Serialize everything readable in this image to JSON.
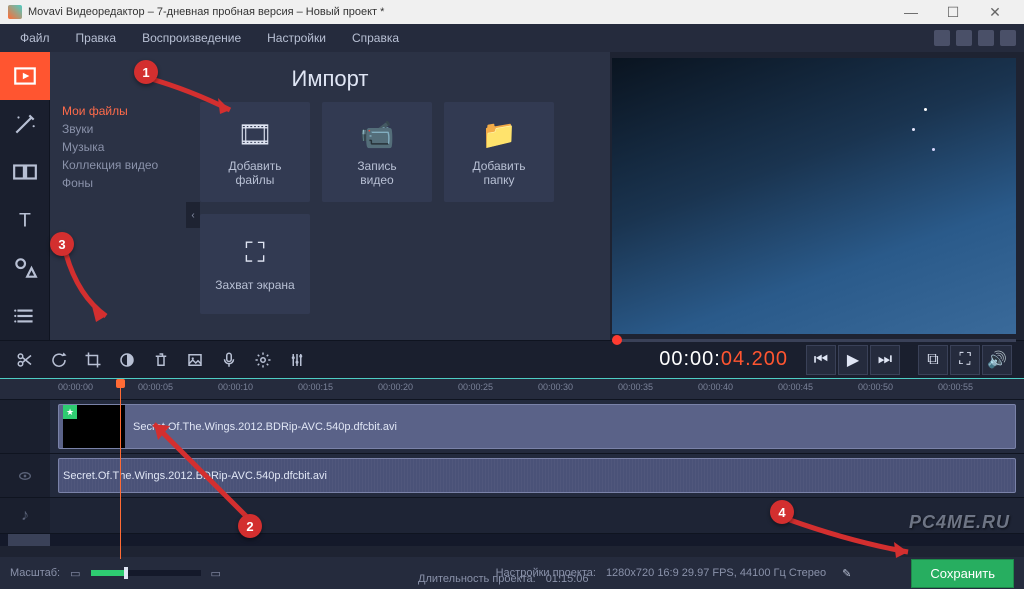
{
  "window": {
    "title": "Movavi Видеоредактор – 7-дневная пробная версия – Новый проект *"
  },
  "menu": {
    "file": "Файл",
    "edit": "Правка",
    "playback": "Воспроизведение",
    "settings": "Настройки",
    "help": "Справка"
  },
  "import": {
    "title": "Импорт",
    "sidebar": {
      "myfiles": "Мои файлы",
      "sounds": "Звуки",
      "music": "Музыка",
      "collection": "Коллекция видео",
      "backgrounds": "Фоны"
    },
    "tiles": {
      "add_files_l1": "Добавить",
      "add_files_l2": "файлы",
      "record_video_l1": "Запись",
      "record_video_l2": "видео",
      "add_folder_l1": "Добавить",
      "add_folder_l2": "папку",
      "screen_capture": "Захват экрана"
    }
  },
  "timecode": {
    "white": "00:00:",
    "orange": "04.200"
  },
  "ruler": {
    "ticks": [
      "00:00:00",
      "00:00:05",
      "00:00:10",
      "00:00:15",
      "00:00:20",
      "00:00:25",
      "00:00:30",
      "00:00:35",
      "00:00:40",
      "00:00:45",
      "00:00:50",
      "00:00:55"
    ]
  },
  "clips": {
    "video_name": "Secret.Of.The.Wings.2012.BDRip-AVC.540p.dfcbit.avi",
    "audio_name": "Secret.Of.The.Wings.2012.BDRip-AVC.540p.dfcbit.avi"
  },
  "bottom": {
    "zoom_label": "Масштаб:",
    "project_settings_label": "Настройки проекта:",
    "project_settings_value": "1280x720 16:9 29.97 FPS, 44100 Гц Стерео",
    "duration_label": "Длительность проекта:",
    "duration_value": "01:15:06",
    "save": "Сохранить"
  },
  "annotations": {
    "n1": "1",
    "n2": "2",
    "n3": "3",
    "n4": "4"
  },
  "watermark": "PC4ME.RU"
}
